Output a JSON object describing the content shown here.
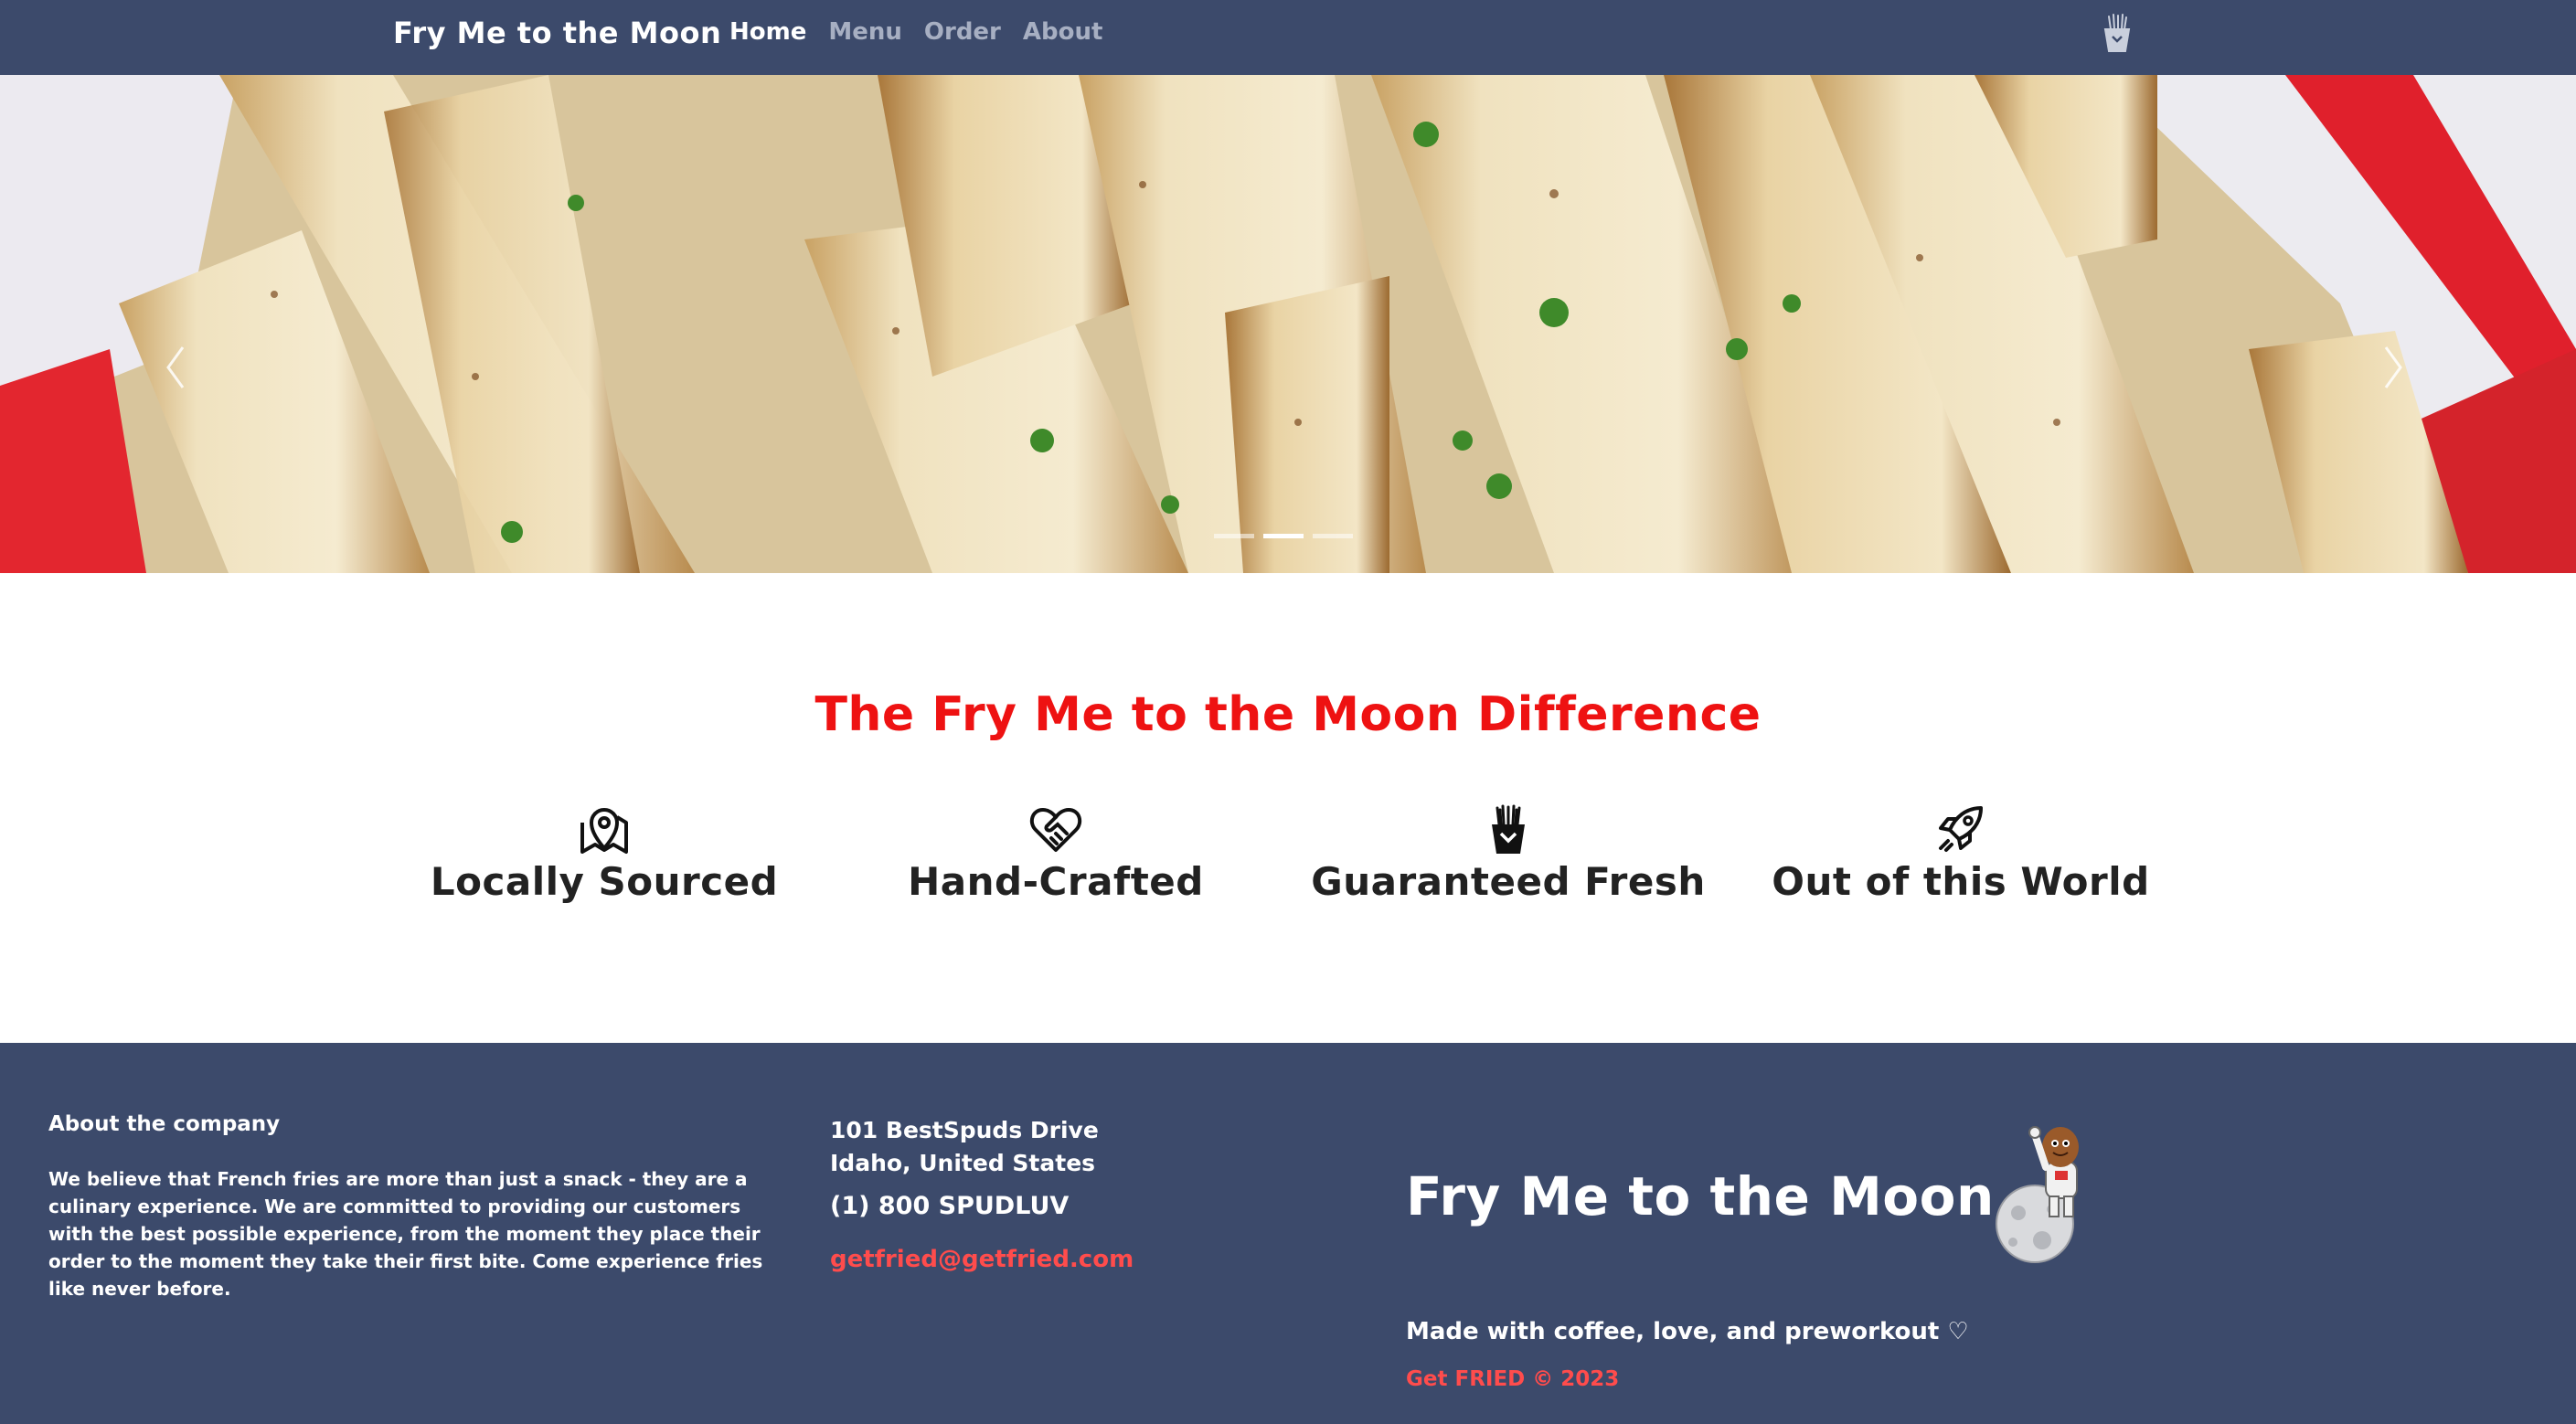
{
  "navbar": {
    "brand": "Fry Me to the Moon",
    "links": [
      {
        "label": "Home",
        "active": true
      },
      {
        "label": "Menu",
        "active": false
      },
      {
        "label": "Order",
        "active": false
      },
      {
        "label": "About",
        "active": false
      }
    ],
    "cart_icon": "fries-cart-icon"
  },
  "carousel": {
    "image": "french-fries-in-basket",
    "slide_count": 3,
    "active_slide": 2,
    "prev_icon": "chevron-left-icon",
    "next_icon": "chevron-right-icon"
  },
  "difference": {
    "title": "The Fry Me to the Moon Difference",
    "features": [
      {
        "icon": "map-pin-icon",
        "label": "Locally Sourced"
      },
      {
        "icon": "heart-handshake-icon",
        "label": "Hand-Crafted"
      },
      {
        "icon": "fries-icon",
        "label": "Guaranteed Fresh"
      },
      {
        "icon": "rocket-icon",
        "label": "Out of this World"
      }
    ]
  },
  "footer": {
    "about_heading": "About the company",
    "about_text": "We believe that French fries are more than just a snack - they are a culinary experience. We are committed to providing our customers with the best possible experience, from the moment they place their order to the moment they take their first bite. Come experience fries like never before.",
    "address_line1": "101 BestSpuds Drive",
    "address_line2": "Idaho, United States",
    "phone": "(1) 800 SPUDLUV",
    "email": "getfried@getfried.com",
    "brand": "Fry Me to the Moon",
    "mascot": "potato-astronaut-on-moon",
    "tagline": "Made with coffee, love, and preworkout ♡",
    "copyright": "Get FRIED © 2023"
  },
  "colors": {
    "navbar_bg": "#3c4a6b",
    "accent_red": "#ee1212",
    "link_red": "#ff4c4c",
    "heading_dark": "#222222"
  }
}
